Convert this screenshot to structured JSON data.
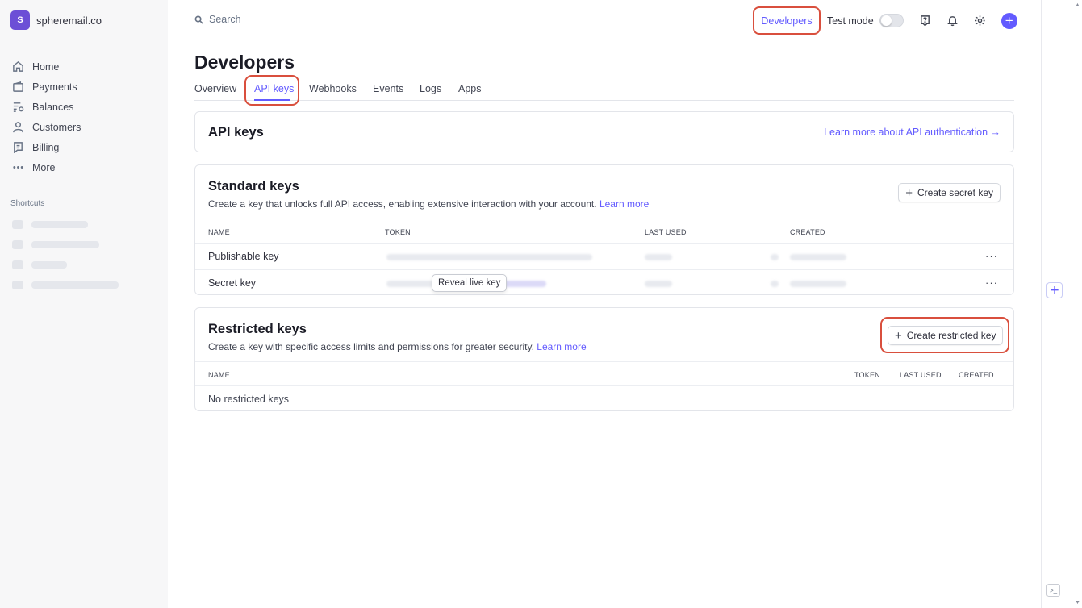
{
  "account": {
    "name": "spheremail.co",
    "logo_letter": "S"
  },
  "sidebar": {
    "items": [
      {
        "label": "Home",
        "icon": "home-icon"
      },
      {
        "label": "Payments",
        "icon": "wallet-icon"
      },
      {
        "label": "Balances",
        "icon": "balances-icon"
      },
      {
        "label": "Customers",
        "icon": "person-icon"
      },
      {
        "label": "Billing",
        "icon": "billing-icon"
      },
      {
        "label": "More",
        "icon": "more-icon"
      }
    ],
    "shortcuts_label": "Shortcuts"
  },
  "topbar": {
    "search_placeholder": "Search",
    "developers_label": "Developers",
    "test_mode_label": "Test mode"
  },
  "page": {
    "title": "Developers",
    "tabs": [
      {
        "label": "Overview",
        "active": false
      },
      {
        "label": "API keys",
        "active": true
      },
      {
        "label": "Webhooks",
        "active": false
      },
      {
        "label": "Events",
        "active": false
      },
      {
        "label": "Logs",
        "active": false
      },
      {
        "label": "Apps",
        "active": false
      }
    ]
  },
  "api_card": {
    "title": "API keys",
    "learn_link": "Learn more about API authentication →"
  },
  "standard": {
    "title": "Standard keys",
    "description": "Create a key that unlocks full API access, enabling extensive interaction with your account.",
    "learn_more": "Learn more",
    "create_button": "Create secret key",
    "columns": [
      "NAME",
      "TOKEN",
      "LAST USED",
      "CREATED"
    ],
    "rows": [
      {
        "name": "Publishable key",
        "menu": "···"
      },
      {
        "name": "Secret key",
        "menu": "···"
      }
    ],
    "reveal_tooltip": "Reveal live key"
  },
  "restricted": {
    "title": "Restricted keys",
    "description": "Create a key with specific access limits and permissions for greater security.",
    "learn_more": "Learn more",
    "create_button": "Create restricted key",
    "columns": [
      "NAME",
      "TOKEN",
      "LAST USED",
      "CREATED"
    ],
    "empty_text": "No restricted keys"
  },
  "colors": {
    "accent": "#635bff",
    "highlight": "#d94f3d",
    "text": "#30313d"
  }
}
